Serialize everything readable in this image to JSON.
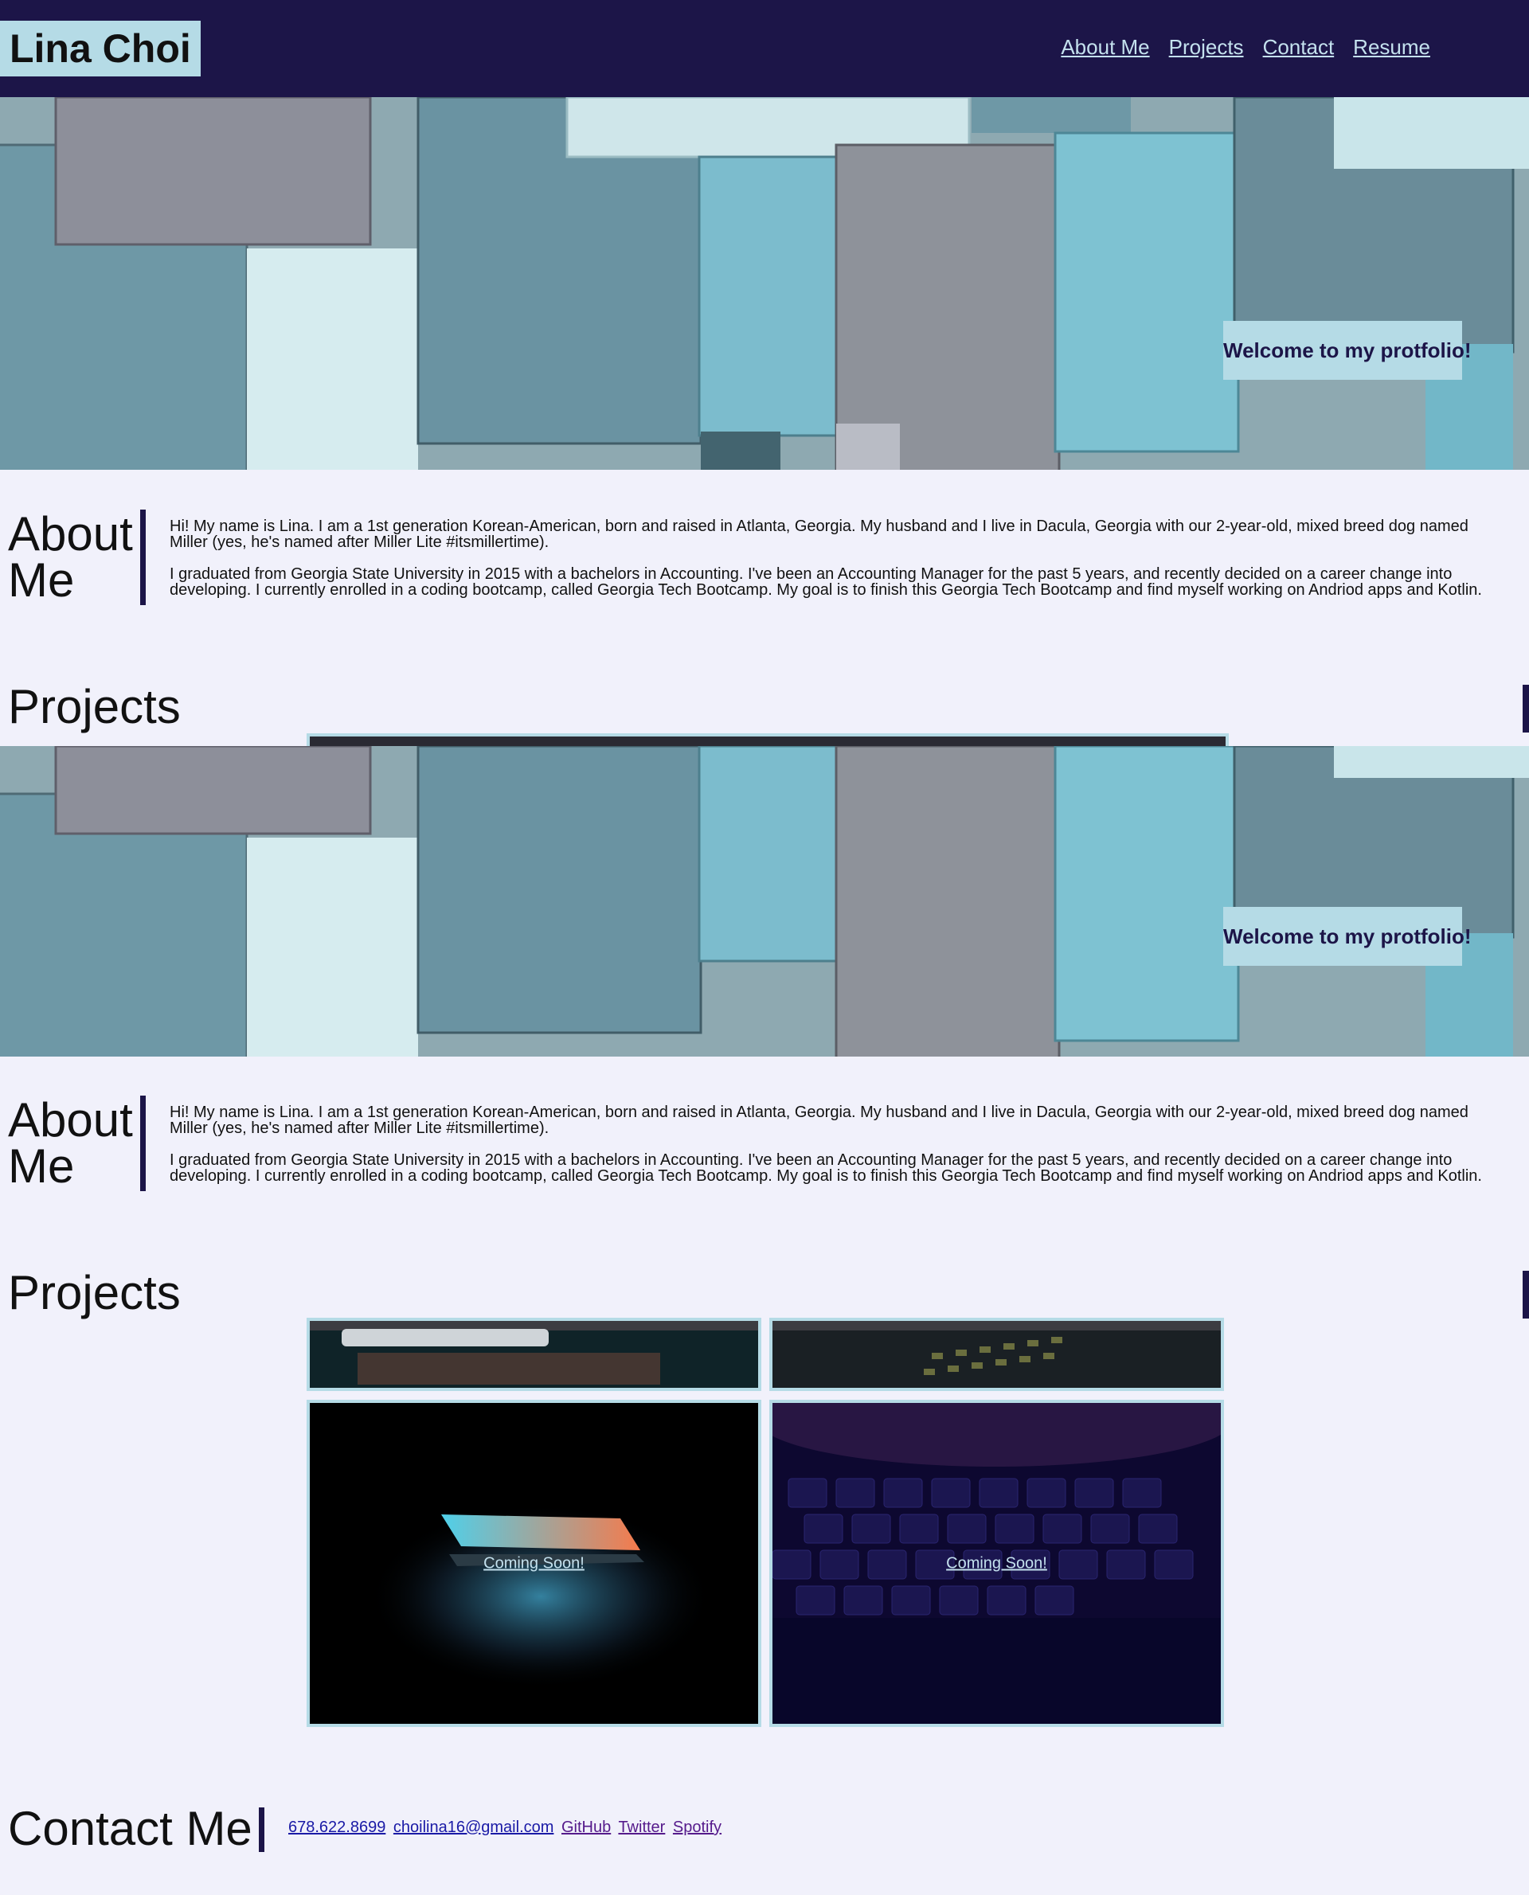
{
  "header": {
    "brand": "Lina Choi",
    "nav": [
      {
        "label": "About Me"
      },
      {
        "label": "Projects"
      },
      {
        "label": "Contact"
      },
      {
        "label": "Resume"
      }
    ]
  },
  "hero": {
    "welcome": "Welcome to my protfolio!"
  },
  "about": {
    "title_line1": "About",
    "title_line2": "Me",
    "para1": "Hi! My name is Lina. I am a 1st generation Korean-American, born and raised in Atlanta, Georgia. My husband and I live in Dacula, Georgia with our 2-year-old, mixed breed dog named Miller (yes, he's named after Miller Lite #itsmillertime).",
    "para2": "I graduated from Georgia State University in 2015 with a bachelors in Accounting. I've been an Accounting Manager for the past 5 years, and recently decided on a career change into developing. I currently enrolled in a coding bootcamp, called Georgia Tech Bootcamp. My goal is to finish this Georgia Tech Bootcamp and find myself working on Andriod apps and Kotlin."
  },
  "projects": {
    "title": "Projects",
    "tiles": [
      {
        "label": "Coming Soon!"
      },
      {
        "label": "Coming Soon!"
      }
    ]
  },
  "contact": {
    "title": "Contact Me",
    "phone": "678.622.8699",
    "email": "choilina16@gmail.com",
    "github": "GitHub",
    "twitter": "Twitter",
    "spotify": "Spotify"
  },
  "colors": {
    "header_bg": "#1c1548",
    "accent": "#b5dbe6",
    "page_bg": "#f1f1fb",
    "nav_link": "#c4e1ee"
  }
}
